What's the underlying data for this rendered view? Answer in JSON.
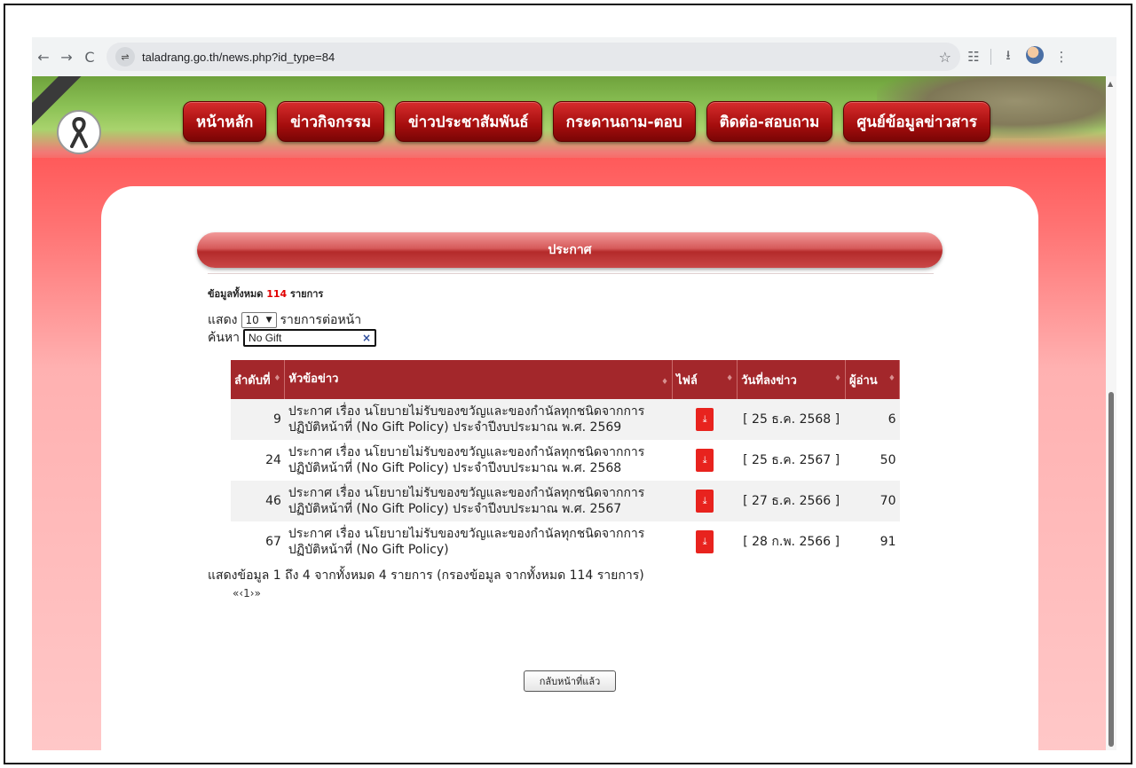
{
  "browser": {
    "back_icon": "←",
    "forward_icon": "→",
    "reload_icon": "C",
    "site_info_icon": "⇌",
    "url": "taladrang.go.th/news.php?id_type=84",
    "star_icon": "☆",
    "reader_icon": "☷",
    "download_icon": "⭳",
    "menu_icon": "⋮"
  },
  "header": {
    "menu": [
      "หน้าหลัก",
      "ข่าวกิจกรรม",
      "ข่าวประชาสัมพันธ์",
      "กระดานถาม-ตอบ",
      "ติดต่อ-สอบถาม",
      "ศูนย์ข้อมูลข่าวสาร"
    ],
    "ribbon_icon": "🎗"
  },
  "section": {
    "title": "ประกาศ",
    "total_prefix": "ข้อมูลทั้งหมด",
    "total_count": "114",
    "total_suffix": "รายการ",
    "length_prefix": "แสดง",
    "length_value": "10",
    "length_suffix": "รายการต่อหน้า",
    "search_label": "ค้นหา",
    "search_value": "No Gift",
    "search_clear": "×"
  },
  "table": {
    "headers": [
      "ลำดับที่",
      "หัวข้อข่าว",
      "ไฟล์",
      "วันที่ลงข่าว",
      "ผู้อ่าน"
    ],
    "sort_icon": "♦",
    "rows": [
      {
        "num": "9",
        "title": "ประกาศ เรื่อง นโยบายไม่รับของขวัญและของกำนัลทุกชนิดจากการปฏิบัติหน้าที่ (No Gift Policy) ประจำปีงบประมาณ พ.ศ. 2569",
        "file_icon": "pdf-icon",
        "date": "[ 25 ธ.ค. 2568 ]",
        "reads": "6"
      },
      {
        "num": "24",
        "title": "ประกาศ เรื่อง นโยบายไม่รับของขวัญและของกำนัลทุกชนิดจากการปฏิบัติหน้าที่ (No Gift Policy) ประจำปีงบประมาณ พ.ศ. 2568",
        "file_icon": "pdf-icon",
        "date": "[ 25 ธ.ค. 2567 ]",
        "reads": "50"
      },
      {
        "num": "46",
        "title": "ประกาศ เรื่อง นโยบายไม่รับของขวัญและของกำนัลทุกชนิดจากการปฏิบัติหน้าที่ (No Gift Policy) ประจำปีงบประมาณ พ.ศ. 2567",
        "file_icon": "pdf-icon",
        "date": "[ 27 ธ.ค. 2566 ]",
        "reads": "70"
      },
      {
        "num": "67",
        "title": "ประกาศ เรื่อง นโยบายไม่รับของขวัญและของกำนัลทุกชนิดจากการปฏิบัติหน้าที่ (No Gift Policy)",
        "file_icon": "pdf-icon",
        "date": "[ 28 ก.พ. 2566 ]",
        "reads": "91"
      }
    ]
  },
  "footer": {
    "info": "แสดงข้อมูล 1 ถึง 4 จากทั้งหมด 4 รายการ (กรองข้อมูล จากทั้งหมด 114 รายการ)",
    "pager": "«‹1›»",
    "back_label": "กลับหน้าที่แล้ว"
  },
  "colors": {
    "menu_red": "#a40d0d",
    "header_row": "#a3272b",
    "count_red": "#e10000",
    "pdf_red": "#e8231e"
  }
}
